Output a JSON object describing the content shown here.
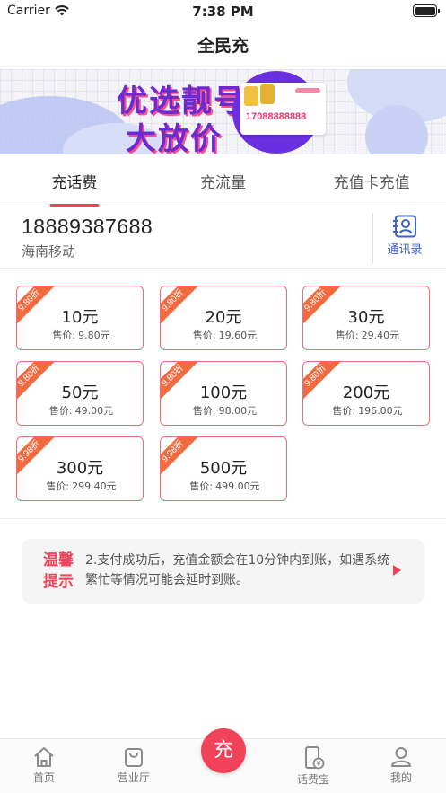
{
  "status_bar": {
    "carrier": "Carrier",
    "time": "7:38 PM"
  },
  "nav": {
    "title": "全民充"
  },
  "banner": {
    "line1": "优选靓号",
    "line2": "大放价",
    "card_number": "17088888888"
  },
  "tabs": [
    {
      "label": "充话费",
      "active": true
    },
    {
      "label": "充流量",
      "active": false
    },
    {
      "label": "充值卡充值",
      "active": false
    }
  ],
  "phone": {
    "number": "18889387688",
    "carrier": "海南移动",
    "contacts_label": "通讯录"
  },
  "price_label": "售价:",
  "products": [
    {
      "discount": "9.80折",
      "amount": "10元",
      "price": "9.80元"
    },
    {
      "discount": "9.80折",
      "amount": "20元",
      "price": "19.60元"
    },
    {
      "discount": "9.80折",
      "amount": "30元",
      "price": "29.40元"
    },
    {
      "discount": "9.80折",
      "amount": "50元",
      "price": "49.00元"
    },
    {
      "discount": "9.80折",
      "amount": "100元",
      "price": "98.00元"
    },
    {
      "discount": "9.80折",
      "amount": "200元",
      "price": "196.00元"
    },
    {
      "discount": "9.98折",
      "amount": "300元",
      "price": "299.40元"
    },
    {
      "discount": "9.98折",
      "amount": "500元",
      "price": "499.00元"
    }
  ],
  "tip": {
    "label": "温馨提示",
    "text": "2.支付成功后，充值金额会在10分钟内到账，如遇系统繁忙等情况可能会延时到账。"
  },
  "bottom_nav": {
    "items": [
      {
        "label": "首页",
        "icon": "home-icon"
      },
      {
        "label": "营业厅",
        "icon": "bag-icon"
      },
      {
        "label": "话费宝",
        "icon": "phone-wallet-icon"
      },
      {
        "label": "我的",
        "icon": "user-icon"
      }
    ],
    "center_label": "充"
  },
  "colors": {
    "accent": "#f0435a",
    "ribbon": "#f26a3f",
    "link": "#3d63c8",
    "banner_purple": "#6a2bd1"
  }
}
